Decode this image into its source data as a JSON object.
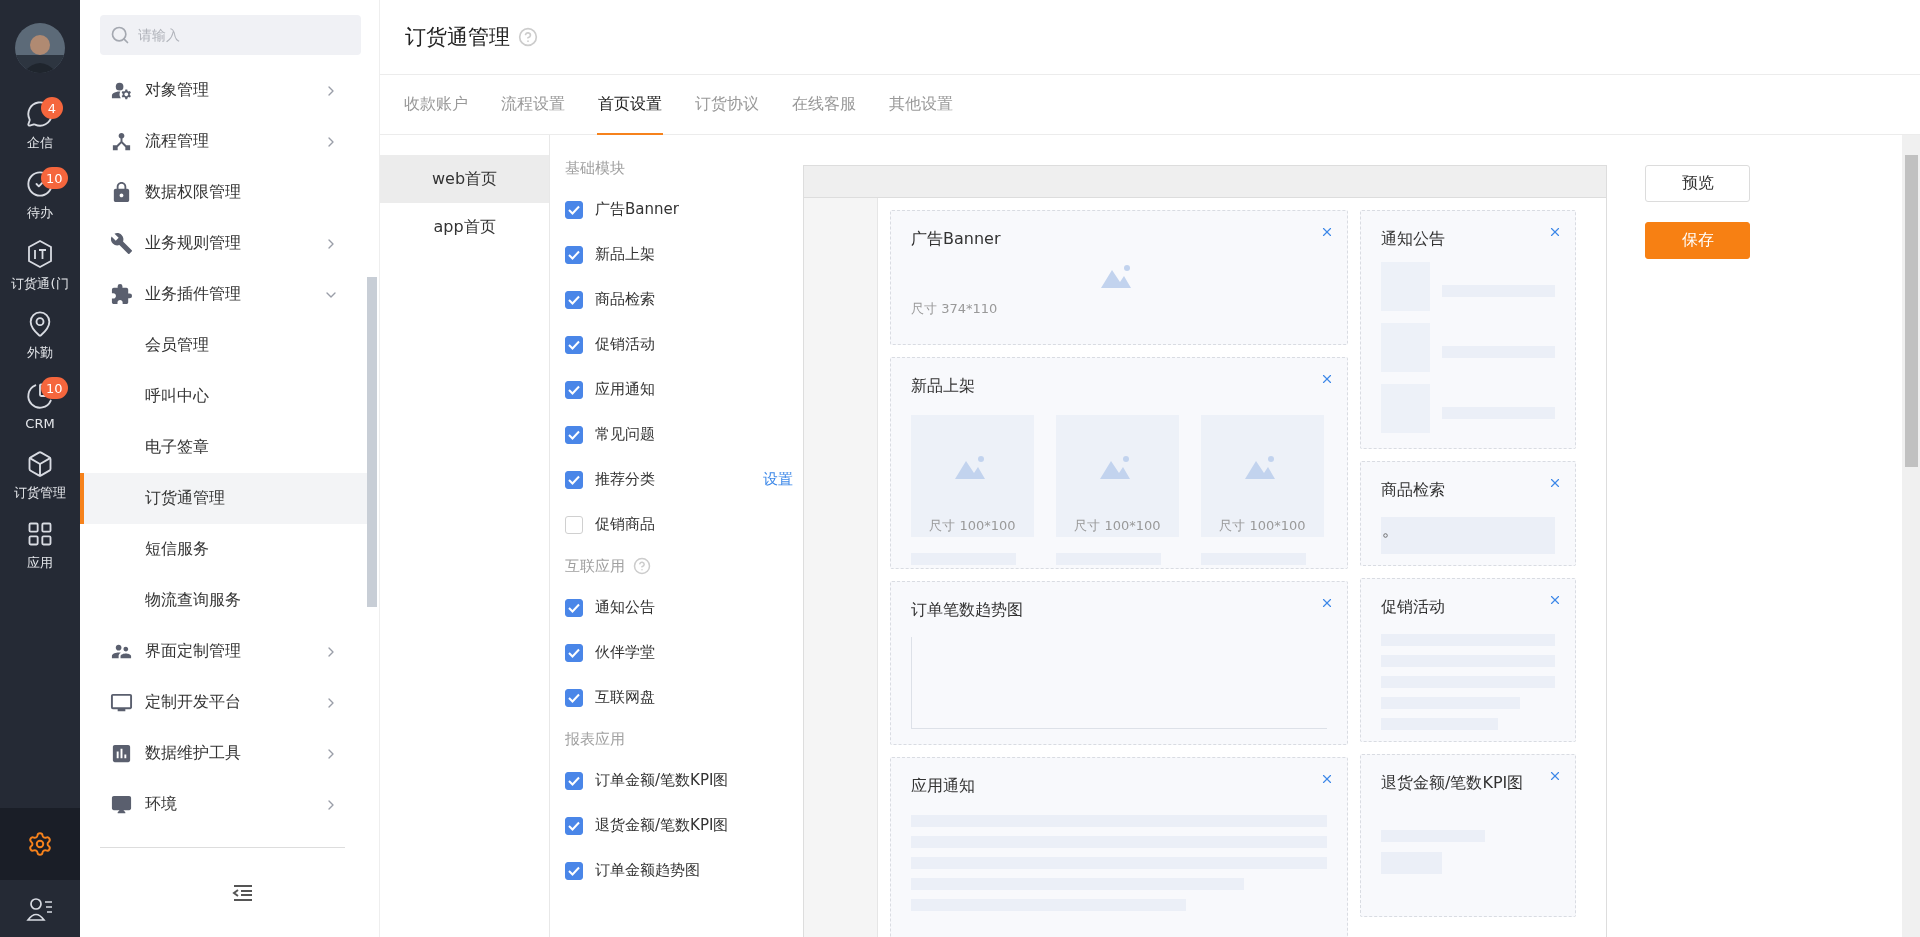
{
  "rail": {
    "items": [
      {
        "label": "企信",
        "badge": "4",
        "selected": false
      },
      {
        "label": "待办",
        "badge": "10",
        "selected": false
      },
      {
        "label": "订货通(门",
        "selected": false
      },
      {
        "label": "外勤",
        "selected": false
      },
      {
        "label": "CRM",
        "badge": "10",
        "selected": false
      },
      {
        "label": "订货管理",
        "selected": false
      },
      {
        "label": "应用",
        "selected": false
      }
    ],
    "bottom": [
      {
        "kind": "settings",
        "selected": true
      },
      {
        "kind": "contacts",
        "selected": false
      }
    ]
  },
  "sidebar": {
    "search_placeholder": "请输入",
    "items": [
      {
        "label": "对象管理",
        "kind": "group",
        "expanded": false
      },
      {
        "label": "流程管理",
        "kind": "group",
        "expanded": false
      },
      {
        "label": "数据权限管理",
        "kind": "link"
      },
      {
        "label": "业务规则管理",
        "kind": "group",
        "expanded": false
      },
      {
        "label": "业务插件管理",
        "kind": "group",
        "expanded": true,
        "children": [
          {
            "label": "会员管理",
            "selected": false
          },
          {
            "label": "呼叫中心",
            "selected": false
          },
          {
            "label": "电子签章",
            "selected": false
          },
          {
            "label": "订货通管理",
            "selected": true
          },
          {
            "label": "短信服务",
            "selected": false
          },
          {
            "label": "物流查询服务",
            "selected": false
          }
        ]
      },
      {
        "label": "界面定制管理",
        "kind": "group",
        "expanded": false
      },
      {
        "label": "定制开发平台",
        "kind": "group",
        "expanded": false
      },
      {
        "label": "数据维护工具",
        "kind": "group",
        "expanded": false
      },
      {
        "label": "环境",
        "kind": "group",
        "expanded": false
      }
    ]
  },
  "page": {
    "title": "订货通管理"
  },
  "tabs": [
    {
      "label": "收款账户",
      "selected": false
    },
    {
      "label": "流程设置",
      "selected": false
    },
    {
      "label": "首页设置",
      "selected": true
    },
    {
      "label": "订货协议",
      "selected": false
    },
    {
      "label": "在线客服",
      "selected": false
    },
    {
      "label": "其他设置",
      "selected": false
    }
  ],
  "home_tabs": [
    {
      "label": "web首页",
      "selected": true
    },
    {
      "label": "app首页",
      "selected": false
    }
  ],
  "module_groups": [
    {
      "title": "基础模块",
      "help": false,
      "items": [
        {
          "label": "广告Banner",
          "checked": true
        },
        {
          "label": "新品上架",
          "checked": true
        },
        {
          "label": "商品检索",
          "checked": true
        },
        {
          "label": "促销活动",
          "checked": true
        },
        {
          "label": "应用通知",
          "checked": true
        },
        {
          "label": "常见问题",
          "checked": true
        },
        {
          "label": "推荐分类",
          "checked": true,
          "action": "设置"
        },
        {
          "label": "促销商品",
          "checked": false
        }
      ]
    },
    {
      "title": "互联应用",
      "help": true,
      "items": [
        {
          "label": "通知公告",
          "checked": true
        },
        {
          "label": "伙伴学堂",
          "checked": true
        },
        {
          "label": "互联网盘",
          "checked": true
        }
      ]
    },
    {
      "title": "报表应用",
      "help": false,
      "items": [
        {
          "label": "订单金额/笔数KPI图",
          "checked": true
        },
        {
          "label": "退货金额/笔数KPI图",
          "checked": true
        },
        {
          "label": "订单金额趋势图",
          "checked": true
        }
      ]
    }
  ],
  "preview": {
    "left_cards": [
      {
        "kind": "banner",
        "title": "广告Banner",
        "size": "尺寸 374*110"
      },
      {
        "kind": "products",
        "title": "新品上架",
        "tiles": [
          "尺寸 100*100",
          "尺寸 100*100",
          "尺寸 100*100"
        ]
      },
      {
        "kind": "chart",
        "title": "订单笔数趋势图"
      },
      {
        "kind": "lines",
        "title": "应用通知"
      }
    ],
    "right_cards": [
      {
        "kind": "notice",
        "title": "通知公告"
      },
      {
        "kind": "search",
        "title": "商品检索"
      },
      {
        "kind": "list",
        "title": "促销活动"
      },
      {
        "kind": "kpi",
        "title": "退货金额/笔数KPI图"
      }
    ]
  },
  "buttons": [
    {
      "label": "预览",
      "kind": "default"
    },
    {
      "label": "保存",
      "kind": "primary"
    }
  ]
}
